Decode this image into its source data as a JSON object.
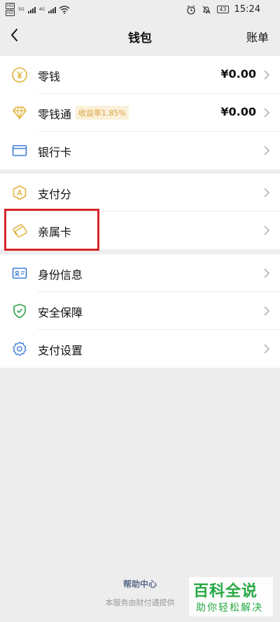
{
  "status_bar": {
    "sim1": "HD",
    "sim2": "HD",
    "network1": "5G",
    "network2": "4G",
    "battery": "43",
    "time": "15:24"
  },
  "nav": {
    "title": "钱包",
    "right_action": "账单"
  },
  "groups": {
    "balance": [
      {
        "label": "零钱",
        "value": "¥0.00",
        "icon": "yuan-coin-icon"
      },
      {
        "label": "零钱通",
        "badge": "收益率1.85%",
        "value": "¥0.00",
        "icon": "diamond-icon"
      },
      {
        "label": "银行卡",
        "icon": "bank-card-icon"
      }
    ],
    "services": [
      {
        "label": "支付分",
        "icon": "pay-score-icon"
      },
      {
        "label": "亲属卡",
        "icon": "family-card-icon"
      }
    ],
    "settings": [
      {
        "label": "身份信息",
        "icon": "id-card-icon"
      },
      {
        "label": "安全保障",
        "icon": "shield-check-icon"
      },
      {
        "label": "支付设置",
        "icon": "gear-icon"
      }
    ]
  },
  "colors": {
    "accent_gold": "#e0b43c",
    "accent_blue": "#3d7dd8",
    "accent_green": "#2fa14b",
    "highlight_red": "#d6242c",
    "watermark_green": "#27a844"
  },
  "footer": {
    "help_link": "帮助中心",
    "note": "本服务由财付通提供"
  },
  "watermark": {
    "main": "百科全说",
    "sub": "助你轻松解决"
  }
}
